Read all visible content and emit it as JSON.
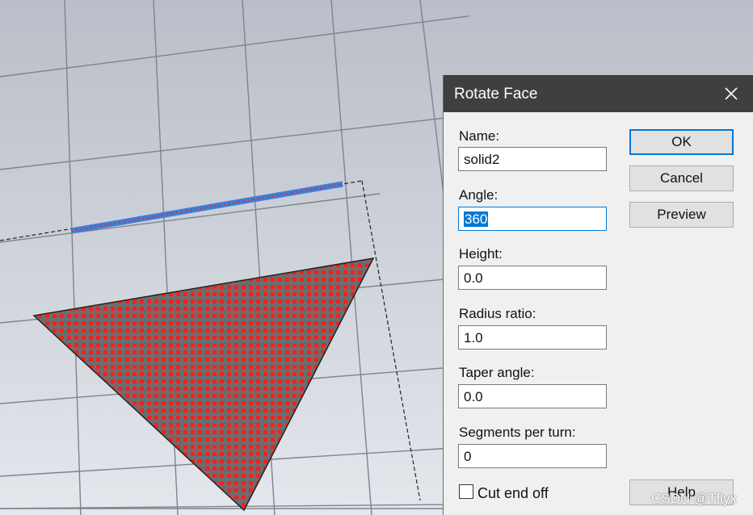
{
  "dialog": {
    "title": "Rotate Face",
    "fields": {
      "name_label": "Name:",
      "name_value": "solid2",
      "angle_label": "Angle:",
      "angle_value": "360",
      "height_label": "Height:",
      "height_value": "0.0",
      "radius_ratio_label": "Radius ratio:",
      "radius_ratio_value": "1.0",
      "taper_angle_label": "Taper angle:",
      "taper_angle_value": "0.0",
      "segments_label": "Segments per turn:",
      "segments_value": "0"
    },
    "buttons": {
      "ok": "OK",
      "cancel": "Cancel",
      "preview": "Preview",
      "help": "Help"
    },
    "cut_end_off": {
      "label": "Cut end off",
      "checked": false
    },
    "icons": {
      "close": "close-icon"
    }
  },
  "viewport": {
    "colors": {
      "background": "#c9ced6",
      "grid": "#7e848c",
      "face": "#e83232",
      "edge": "#3b7fd9"
    }
  },
  "watermark": "CSDN @Tflyx"
}
